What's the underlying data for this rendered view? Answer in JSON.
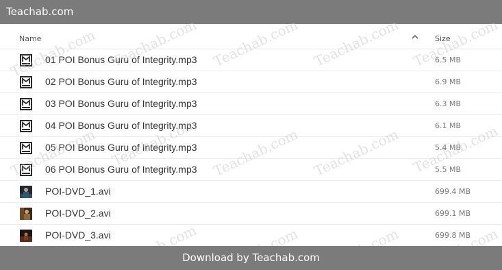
{
  "topbar": {
    "title": "Teachab.com"
  },
  "header": {
    "name_label": "Name",
    "size_label": "Size",
    "sort_icon": "chevron-up-icon"
  },
  "files": [
    {
      "name": "01 POI Bonus Guru of Integrity.mp3",
      "size": "6.5 MB",
      "type": "mp3"
    },
    {
      "name": "02 POI Bonus Guru of Integrity.mp3",
      "size": "6.9 MB",
      "type": "mp3"
    },
    {
      "name": "03 POI Bonus Guru of Integrity.mp3",
      "size": "6.3 MB",
      "type": "mp3"
    },
    {
      "name": "04 POI Bonus Guru of Integrity.mp3",
      "size": "6.1 MB",
      "type": "mp3"
    },
    {
      "name": "05 POI Bonus Guru of Integrity.mp3",
      "size": "5.4 MB",
      "type": "mp3"
    },
    {
      "name": "06 POI Bonus Guru of Integrity.mp3",
      "size": "5.5 MB",
      "type": "mp3"
    },
    {
      "name": "POI-DVD_1.avi",
      "size": "699.4 MB",
      "type": "video"
    },
    {
      "name": "POI-DVD_2.avi",
      "size": "699.1 MB",
      "type": "video"
    },
    {
      "name": "POI-DVD_3.avi",
      "size": "699.8 MB",
      "type": "video"
    }
  ],
  "watermark_text": "Teachab.com",
  "footer": {
    "label": "Download by Teachab.com"
  },
  "colors": {
    "bar": "#7b7b7b",
    "mp3_thumb": "#2b2b2b"
  }
}
